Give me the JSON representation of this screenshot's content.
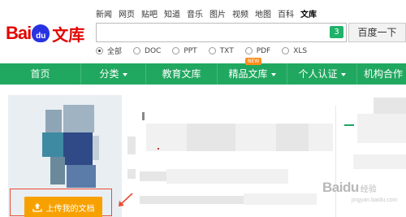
{
  "top_links": [
    "新闻",
    "网页",
    "贴吧",
    "知道",
    "音乐",
    "图片",
    "视频",
    "地图",
    "百科",
    "文库"
  ],
  "top_links_active": "文库",
  "logo": {
    "bai": "Bai",
    "du": "du",
    "wenku": "文库"
  },
  "search": {
    "value": "",
    "badge": "3",
    "button_label": "百度一下"
  },
  "radios": [
    {
      "label": "全部",
      "checked": true
    },
    {
      "label": "DOC",
      "checked": false
    },
    {
      "label": "PPT",
      "checked": false
    },
    {
      "label": "TXT",
      "checked": false
    },
    {
      "label": "PDF",
      "checked": false
    },
    {
      "label": "XLS",
      "checked": false
    }
  ],
  "nav": {
    "items": [
      {
        "label": "首页",
        "dropdown": false
      },
      {
        "label": "分类",
        "dropdown": true
      },
      {
        "label": "教育文库",
        "dropdown": false
      },
      {
        "label": "精品文库",
        "dropdown": true
      },
      {
        "label": "个人认证",
        "dropdown": true
      },
      {
        "label": "机构合作",
        "dropdown": false
      }
    ],
    "new_badge": "NEW"
  },
  "upload_button": {
    "label": "上传我的文档"
  },
  "watermark": {
    "text": "Baidu",
    "cn": "经验",
    "sub": "jingyan.baidu.com"
  },
  "colors": {
    "nav_green": "#21a860",
    "upload_orange": "#f7a100",
    "highlight_red": "#e94b35",
    "logo_red": "#e10601",
    "logo_blue": "#2932e1"
  }
}
